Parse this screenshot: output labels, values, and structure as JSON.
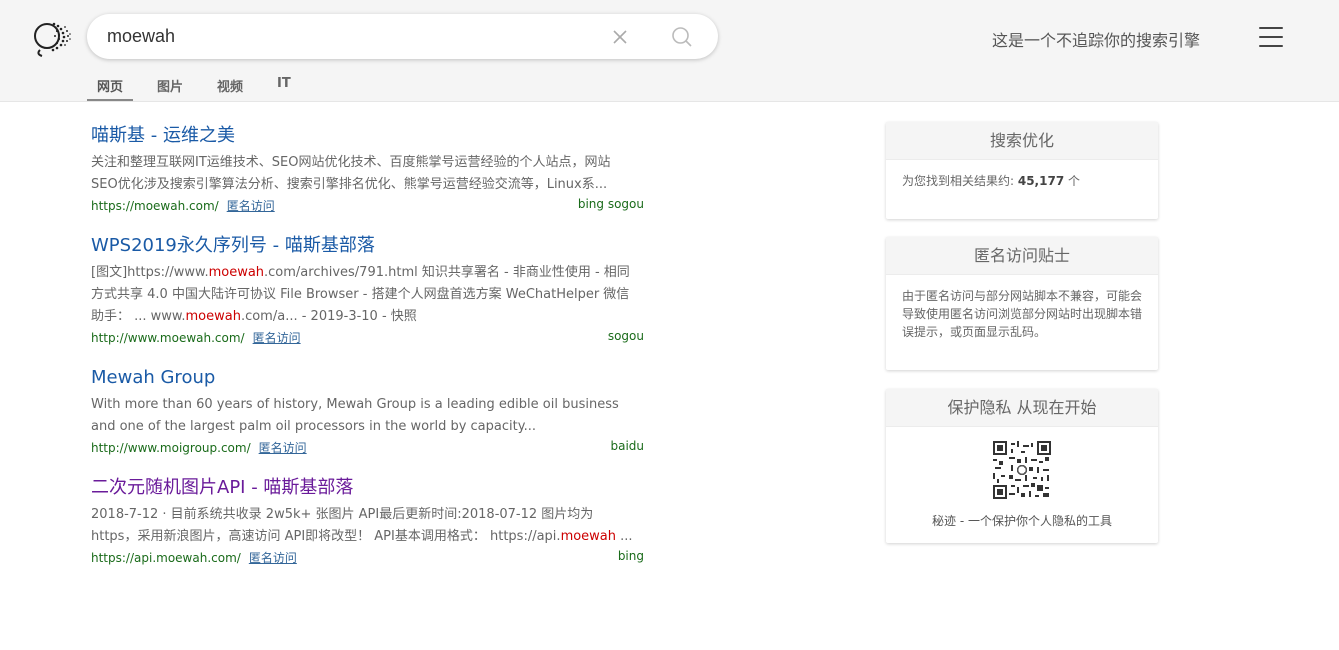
{
  "header": {
    "search": {
      "value": "moewah",
      "placeholder": ""
    },
    "slogan": "这是一个不追踪你的搜索引擎",
    "tabs": [
      {
        "label": "网页",
        "active": true
      },
      {
        "label": "图片",
        "active": false
      },
      {
        "label": "视频",
        "active": false
      },
      {
        "label": "IT",
        "active": false
      }
    ]
  },
  "results": [
    {
      "title": "喵斯基 - 运维之美",
      "snippet": "关注和整理互联网IT运维技术、SEO网站优化技术、百度熊掌号运营经验的个人站点，网站SEO优化涉及搜索引擎算法分析、搜索引擎排名优化、熊掌号运营经验交流等，Linux系...",
      "url": "https://moewah.com/",
      "anon_label": "匿名访问",
      "engines": "bing sogou"
    },
    {
      "title": "WPS2019永久序列号 - 喵斯基部落",
      "snippet_parts": [
        "[图文]https://www.",
        "moewah",
        ".com/archives/791.html 知识共享署名 - 非商业性使用 - 相同方式共享 4.0 中国大陆许可协议 File Browser - 搭建个人网盘首选方案 WeChatHelper 微信助手： ... www.",
        "moewah",
        ".com/a... - 2019-3-10 - 快照"
      ],
      "url": "http://www.moewah.com/",
      "anon_label": "匿名访问",
      "engines": "sogou"
    },
    {
      "title": "Mewah Group",
      "snippet": "With more than 60 years of history, Mewah Group is a leading edible oil business and one of the largest palm oil processors in the world by capacity...",
      "url": "http://www.moigroup.com/",
      "anon_label": "匿名访问",
      "engines": "baidu"
    },
    {
      "title": "二次元随机图片API - 喵斯基部落",
      "snippet_parts": [
        "2018-7-12 · 目前系统共收录 2w5k+ 张图片 API最后更新时间:2018-07-12 图片均为https，采用新浪图片，高速访问 API即将改型！ API基本调用格式： https://api.",
        "moewah",
        " ..."
      ],
      "url": "https://api.moewah.com/",
      "anon_label": "匿名访问",
      "engines": "bing"
    }
  ],
  "sidebar": {
    "seo": {
      "title": "搜索优化",
      "prefix": "为您找到相关结果约: ",
      "count": "45,177",
      "suffix": " 个"
    },
    "tips": {
      "title": "匿名访问贴士",
      "body": "由于匿名访问与部分网站脚本不兼容，可能会导致使用匿名访问浏览部分网站时出现脚本错误提示，或页面显示乱码。"
    },
    "privacy": {
      "title": "保护隐私 从现在开始",
      "caption": "秘迹 - 一个保护你个人隐私的工具"
    }
  },
  "colors": {
    "link": "#1a5aa6",
    "visited": "#6a1b9a",
    "url_green": "#1a6b1a",
    "highlight": "#cc0000"
  }
}
